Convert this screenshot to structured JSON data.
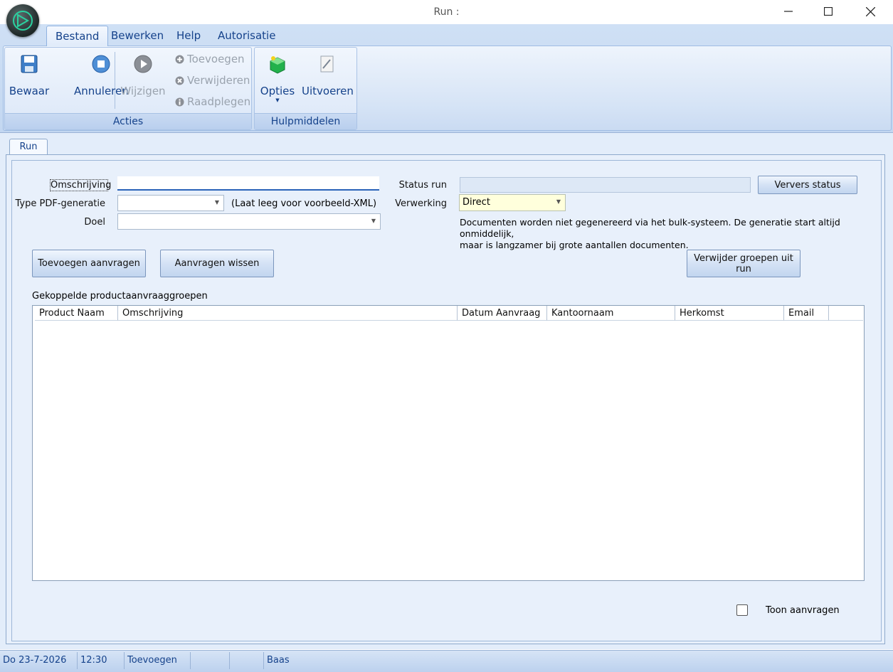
{
  "window": {
    "title": "Run :"
  },
  "ribbon": {
    "tabs": [
      "Bestand",
      "Bewerken",
      "Help",
      "Autorisatie"
    ],
    "acties": {
      "label": "Acties",
      "bewaar": "Bewaar",
      "annuleren": "Annuleren",
      "wijzigen": "Wijzigen",
      "toevoegen": "Toevoegen",
      "verwijderen": "Verwijderen",
      "raadplegen": "Raadplegen"
    },
    "hulpmiddelen": {
      "label": "Hulpmiddelen",
      "opties": "Opties",
      "uitvoeren": "Uitvoeren"
    }
  },
  "page_tab": "Run",
  "form": {
    "omschrijving_label": "Omschrijving",
    "omschrijving_value": "",
    "type_pdf_label": "Type PDF-generatie",
    "type_pdf_value": "",
    "type_pdf_hint": "(Laat leeg voor voorbeeld-XML)",
    "doel_label": "Doel",
    "doel_value": "",
    "status_run_label": "Status run",
    "status_run_value": "",
    "ververs_status": "Ververs status",
    "verwerking_label": "Verwerking",
    "verwerking_value": "Direct",
    "verwerking_info_1": "Documenten worden niet gegenereerd via het bulk-systeem. De generatie start altijd onmiddelijk,",
    "verwerking_info_2": "maar is langzamer bij grote aantallen documenten."
  },
  "buttons": {
    "toevoegen_aanvragen": "Toevoegen aanvragen",
    "aanvragen_wissen": "Aanvragen wissen",
    "verwijder_groepen": "Verwijder groepen uit run"
  },
  "grid": {
    "title": "Gekoppelde productaanvraaggroepen",
    "columns": [
      "Product Naam",
      "Omschrijving",
      "Datum Aanvraag",
      "Kantoornaam",
      "Herkomst",
      "Email"
    ],
    "rows": []
  },
  "toon_aanvragen": {
    "label": "Toon aanvragen",
    "checked": false
  },
  "statusbar": {
    "date": "Do  23-7-2026",
    "time": "12:30",
    "mode": "Toevoegen",
    "empty1": "",
    "empty2": "",
    "user": "Baas"
  }
}
